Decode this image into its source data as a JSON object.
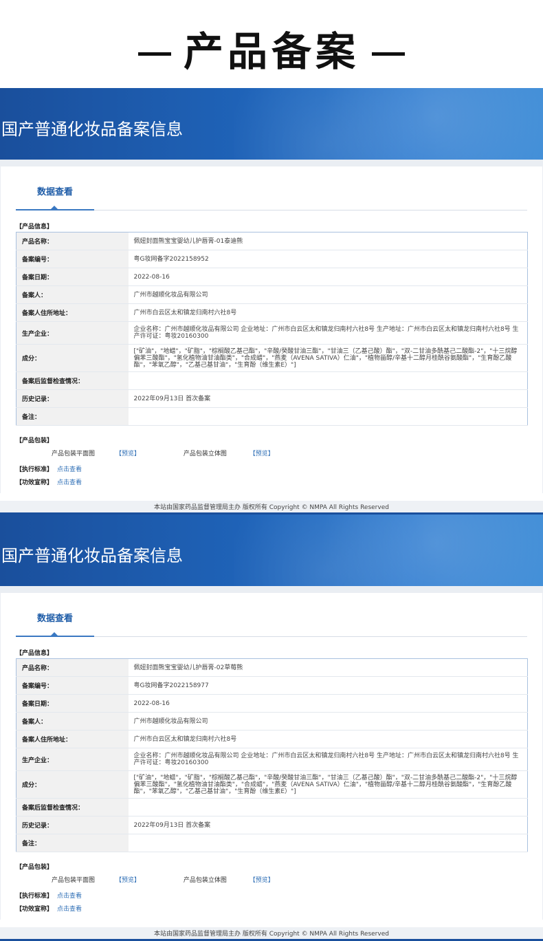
{
  "header": {
    "title": "产品备案"
  },
  "banner_title": "国产普通化妆品备案信息",
  "tab_label": "数据查看",
  "section_product_info": "【产品信息】",
  "section_packaging": "【产品包装】",
  "pkg_flat": "产品包装平面图",
  "pkg_3d": "产品包装立体图",
  "preview": "【预览】",
  "standard_label": "【执行标准】",
  "efficacy_label": "【功效宣称】",
  "view_link": "点击查看",
  "footer": "本站由国家药品监督管理局主办 版权所有 Copyright © NMPA All Rights Reserved",
  "labels": {
    "name": "产品名称：",
    "reg_no": "备案编号：",
    "reg_date": "备案日期：",
    "filer": "备案人：",
    "filer_addr": "备案人住所地址：",
    "manufacturer": "生产企业：",
    "ingredients": "成分：",
    "post_check": "备案后监督检查情况：",
    "history": "历史记录：",
    "remark": "备注："
  },
  "records": [
    {
      "name": "佩妞封面熊宝宝婴幼儿护唇膏-01泰迪熊",
      "reg_no": "粤G妆网备字2022158952",
      "reg_date": "2022-08-16",
      "filer": "广州市越顺化妆品有限公司",
      "filer_addr": "广州市白云区太和镇龙归南村六社8号",
      "manufacturer": "企业名称：广州市越顺化妆品有限公司 企业地址：广州市白云区太和镇龙归南村六社8号 生产地址：广州市白云区太和镇龙归南村六社8号 生产许可证：粤妆20160300",
      "ingredients": "[\"矿油\"，\"地蜡\"，\"矿脂\"，\"棕榈酸乙基己酯\"，\"辛酸/癸酸甘油三酯\"，\"甘油三（乙基己酸）酯\"，\"双-二甘油多酰基己二酸酯-2\"，\"十三烷醇偏苯三酸酯\"，\"氢化植物油甘油酯类\"，\"合成蜡\"，\"燕麦（AVENA SATIVA）仁油\"，\"植物甾醇/辛基十二醇月桂酰谷氨酸酯\"，\"生育酚乙酸酯\"，\"苯氧乙醇\"，\"乙基己基甘油\"，\"生育酚（维生素E）\"]",
      "post_check": "",
      "history": "2022年09月13日 首次备案",
      "remark": ""
    },
    {
      "name": "佩妞封面熊宝宝婴幼儿护唇膏-02草莓熊",
      "reg_no": "粤G妆网备字2022158977",
      "reg_date": "2022-08-16",
      "filer": "广州市越顺化妆品有限公司",
      "filer_addr": "广州市白云区太和镇龙归南村六社8号",
      "manufacturer": "企业名称：广州市越顺化妆品有限公司 企业地址：广州市白云区太和镇龙归南村六社8号 生产地址：广州市白云区太和镇龙归南村六社8号 生产许可证：粤妆20160300",
      "ingredients": "[\"矿油\"，\"地蜡\"，\"矿脂\"，\"棕榈酸乙基己酯\"，\"辛酸/癸酸甘油三酯\"，\"甘油三（乙基己酸）酯\"，\"双-二甘油多酰基己二酸酯-2\"，\"十三烷醇偏苯三酸酯\"，\"氢化植物油甘油酯类\"，\"合成蜡\"，\"燕麦（AVENA SATIVA）仁油\"，\"植物甾醇/辛基十二醇月桂酰谷氨酸酯\"，\"生育酚乙酸酯\"，\"苯氧乙醇\"，\"乙基己基甘油\"，\"生育酚（维生素E）\"]",
      "post_check": "",
      "history": "2022年09月13日 首次备案",
      "remark": ""
    }
  ]
}
